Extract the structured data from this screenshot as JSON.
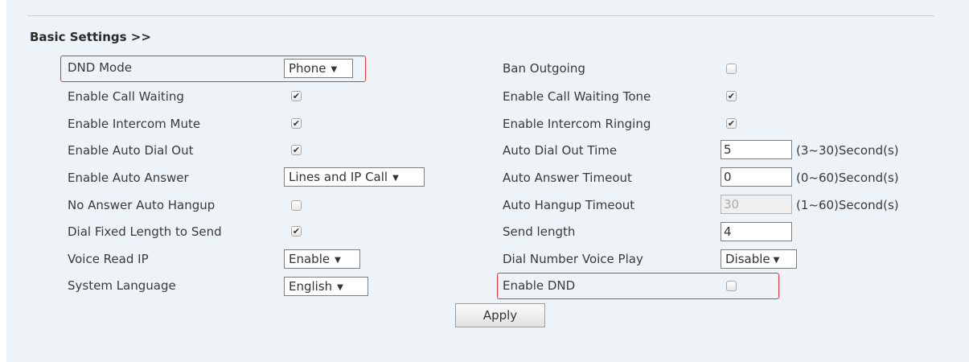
{
  "section_title": "Basic Settings >>",
  "left": {
    "dnd_mode": {
      "label": "DND Mode",
      "value": "Phone"
    },
    "call_waiting": {
      "label": "Enable Call Waiting",
      "checked": true
    },
    "intercom_mute": {
      "label": "Enable Intercom Mute",
      "checked": true
    },
    "auto_dial_out": {
      "label": "Enable Auto Dial Out",
      "checked": true
    },
    "auto_answer": {
      "label": "Enable Auto Answer",
      "value": "Lines and IP Call"
    },
    "no_answer_hangup": {
      "label": "No Answer Auto Hangup",
      "checked": false
    },
    "dial_fixed_length": {
      "label": "Dial Fixed Length to Send",
      "checked": true
    },
    "voice_read_ip": {
      "label": "Voice Read IP",
      "value": "Enable"
    },
    "system_language": {
      "label": "System Language",
      "value": "English"
    }
  },
  "right": {
    "ban_outgoing": {
      "label": "Ban Outgoing",
      "checked": false
    },
    "call_waiting_tone": {
      "label": "Enable Call Waiting Tone",
      "checked": true
    },
    "intercom_ringing": {
      "label": "Enable Intercom Ringing",
      "checked": true
    },
    "auto_dial_out_time": {
      "label": "Auto Dial Out Time",
      "value": "5",
      "hint": "(3~30)Second(s)"
    },
    "auto_answer_timeout": {
      "label": "Auto Answer Timeout",
      "value": "0",
      "hint": "(0~60)Second(s)"
    },
    "auto_hangup_timeout": {
      "label": "Auto Hangup Timeout",
      "value": "30",
      "hint": "(1~60)Second(s)"
    },
    "send_length": {
      "label": "Send length",
      "value": "4"
    },
    "dial_number_voice_play": {
      "label": "Dial Number Voice Play",
      "value": "Disable"
    },
    "enable_dnd": {
      "label": "Enable DND",
      "checked": false
    }
  },
  "apply_label": "Apply",
  "colors": {
    "highlight": "#e0383d",
    "panel_bg": "#eef3f7"
  }
}
